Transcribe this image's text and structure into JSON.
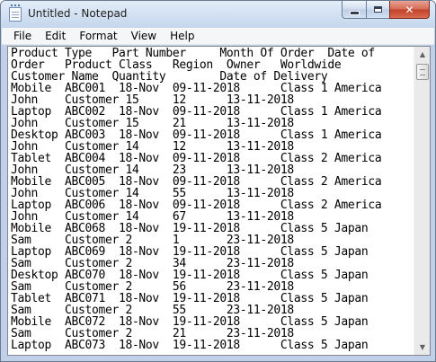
{
  "window": {
    "title": "Untitled - Notepad",
    "icon": "notepad-icon",
    "controls": {
      "minimize": "minimize-icon",
      "maximize": "maximize-icon",
      "close": "close-icon"
    }
  },
  "menu": [
    "File",
    "Edit",
    "Format",
    "View",
    "Help"
  ],
  "document": {
    "lines": [
      "Product Type   Part Number     Month Of Order  Date of",
      "Order   Product Class   Region  Owner   Worldwide",
      "Customer Name  Quantity        Date of Delivery",
      "Mobile  ABC001  18-Nov  09-11-2018      Class 1 America",
      "John    Customer 15     12      13-11-2018",
      "Laptop  ABC002  18-Nov  09-11-2018      Class 1 America",
      "John    Customer 15     21      13-11-2018",
      "Desktop ABC003  18-Nov  09-11-2018      Class 1 America",
      "John    Customer 14     12      13-11-2018",
      "Tablet  ABC004  18-Nov  09-11-2018      Class 2 America",
      "John    Customer 14     23      13-11-2018",
      "Mobile  ABC005  18-Nov  09-11-2018      Class 2 America",
      "John    Customer 14     55      13-11-2018",
      "Laptop  ABC006  18-Nov  09-11-2018      Class 2 America",
      "John    Customer 14     67      13-11-2018",
      "Mobile  ABC068  18-Nov  19-11-2018      Class 5 Japan",
      "Sam     Customer 2      1       23-11-2018",
      "Laptop  ABC069  18-Nov  19-11-2018      Class 5 Japan",
      "Sam     Customer 2      34      23-11-2018",
      "Desktop ABC070  18-Nov  19-11-2018      Class 5 Japan",
      "Sam     Customer 2      56      23-11-2018",
      "Tablet  ABC071  18-Nov  19-11-2018      Class 5 Japan",
      "Sam     Customer 2      55      23-11-2018",
      "Mobile  ABC072  18-Nov  19-11-2018      Class 5 Japan",
      "Sam     Customer 2      21      23-11-2018",
      "Laptop  ABC073  18-Nov  19-11-2018      Class 5 Japan"
    ]
  },
  "scrollbar": {
    "up_arrow": "▲",
    "down_arrow": "▼"
  }
}
